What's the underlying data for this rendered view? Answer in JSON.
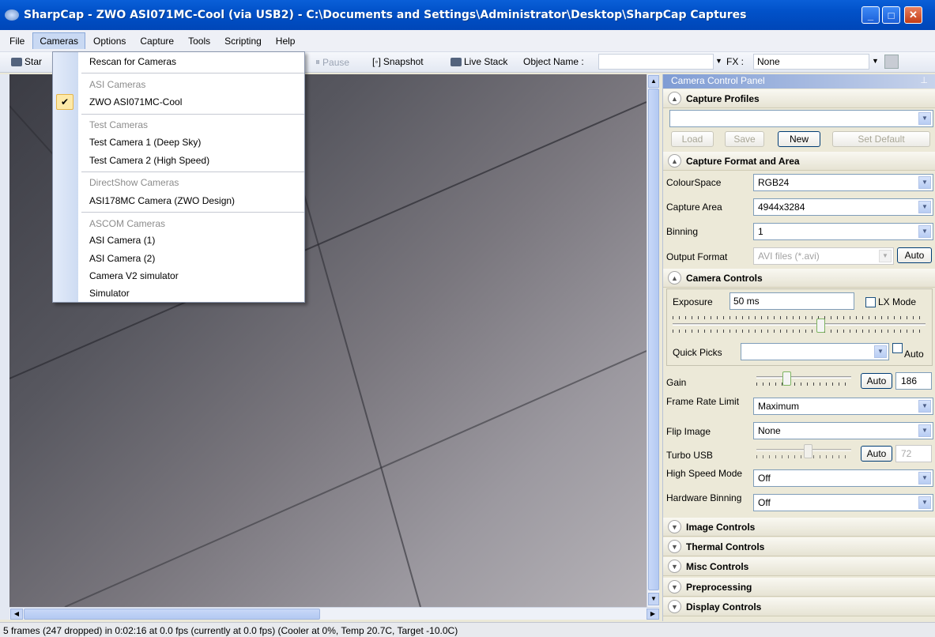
{
  "window": {
    "title": "SharpCap - ZWO ASI071MC-Cool (via USB2) - C:\\Documents and Settings\\Administrator\\Desktop\\SharpCap Captures",
    "minimize": "_",
    "maximize": "□",
    "close": "✕"
  },
  "menubar": [
    "File",
    "Cameras",
    "Options",
    "Capture",
    "Tools",
    "Scripting",
    "Help"
  ],
  "toolbar": {
    "start": "Star",
    "pause": "Pause",
    "snapshot": "Snapshot",
    "live_stack": "Live Stack",
    "object_name_label": "Object Name :",
    "object_name_value": "",
    "fx_label": "FX :",
    "fx_value": "None"
  },
  "cameras_menu": {
    "rescan": "Rescan for Cameras",
    "asi_header": "ASI Cameras",
    "asi_item": "ZWO ASI071MC-Cool",
    "test_header": "Test Cameras",
    "test_1": "Test Camera 1 (Deep Sky)",
    "test_2": "Test Camera 2 (High Speed)",
    "directshow_header": "DirectShow Cameras",
    "directshow_1": "ASI178MC Camera (ZWO Design)",
    "ascom_header": "ASCOM Cameras",
    "ascom_1": "ASI Camera (1)",
    "ascom_2": "ASI Camera (2)",
    "ascom_3": "Camera V2 simulator",
    "ascom_4": "Simulator",
    "checked_item": "ZWO ASI071MC-Cool"
  },
  "panel": {
    "title": "Camera Control Panel",
    "capture_profiles": {
      "header": "Capture Profiles",
      "profile_value": "",
      "load": "Load",
      "save": "Save",
      "new": "New",
      "set_default": "Set Default"
    },
    "capture_format": {
      "header": "Capture Format and Area",
      "colourspace_label": "ColourSpace",
      "colourspace_value": "RGB24",
      "capture_area_label": "Capture Area",
      "capture_area_value": "4944x3284",
      "binning_label": "Binning",
      "binning_value": "1",
      "output_format_label": "Output Format",
      "output_format_value": "AVI files (*.avi)",
      "output_auto": "Auto"
    },
    "camera_controls": {
      "header": "Camera Controls",
      "exposure_label": "Exposure",
      "exposure_value": "50 ms",
      "lx_mode_label": "LX Mode",
      "exposure_slider_fraction": 0.59,
      "quick_picks_label": "Quick Picks",
      "quick_picks_value": "",
      "quick_picks_auto": "Auto",
      "gain_label": "Gain",
      "gain_slider_fraction": 0.3,
      "gain_auto": "Auto",
      "gain_value": "186",
      "frame_rate_label": "Frame Rate Limit",
      "frame_rate_value": "Maximum",
      "flip_label": "Flip Image",
      "flip_value": "None",
      "turbo_label": "Turbo USB",
      "turbo_slider_fraction": 0.55,
      "turbo_auto": "Auto",
      "turbo_value": "72",
      "high_speed_label": "High Speed Mode",
      "high_speed_value": "Off",
      "hw_binning_label": "Hardware Binning",
      "hw_binning_value": "Off"
    },
    "collapsed_sections": [
      "Image Controls",
      "Thermal Controls",
      "Misc Controls",
      "Preprocessing",
      "Display Controls"
    ]
  },
  "status": {
    "text": "5 frames (247 dropped) in 0:02:16 at 0.0 fps  (currently at 0.0 fps) (Cooler at 0%, Temp 20.7C, Target -10.0C)"
  }
}
